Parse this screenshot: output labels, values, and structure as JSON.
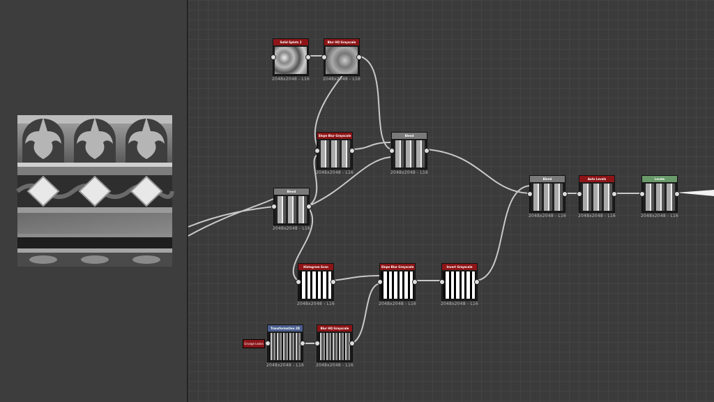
{
  "colors": {
    "red": "#8e1517",
    "blue": "#4a5f8f",
    "green": "#6a9a6a",
    "gray": "#7a7a7a",
    "wire": "#c9c9c9"
  },
  "preview": {
    "label": ""
  },
  "input": {
    "label": "Grunge Leaks"
  },
  "nodes": [
    {
      "id": "n1",
      "title": "Solid Splots 2",
      "size": "2048x2048 - L16",
      "color": "red",
      "thumb": "t-noise"
    },
    {
      "id": "n2",
      "title": "Blur HQ Grayscale",
      "size": "2048x2048 - L16",
      "color": "red",
      "thumb": "t-noise2"
    },
    {
      "id": "n3",
      "title": "Slope Blur Grayscale",
      "size": "2048x2048 - L16",
      "color": "red",
      "thumb": "t-pattern"
    },
    {
      "id": "n4",
      "title": "Blend",
      "size": "2048x2048 - L16",
      "color": "gray",
      "thumb": "t-pattern"
    },
    {
      "id": "n5",
      "title": "Blend",
      "size": "2048x2048 - L16",
      "color": "gray",
      "thumb": "t-pattern"
    },
    {
      "id": "n6",
      "title": "Blend",
      "size": "2048x2048 - L16",
      "color": "gray",
      "thumb": "t-pattern"
    },
    {
      "id": "n7",
      "title": "Auto Levels",
      "size": "2048x2048 - L16",
      "color": "red",
      "thumb": "t-pattern"
    },
    {
      "id": "n8",
      "title": "Levels",
      "size": "2048x2048 - L16",
      "color": "green",
      "thumb": "t-pattern"
    },
    {
      "id": "n9",
      "title": "Histogram Scan",
      "size": "2048x2048 - L16",
      "color": "red",
      "thumb": "t-bw"
    },
    {
      "id": "n10",
      "title": "Slope Blur Grayscale",
      "size": "2048x2048 - L16",
      "color": "red",
      "thumb": "t-bw"
    },
    {
      "id": "n11",
      "title": "Invert Grayscale",
      "size": "2048x2048 - L16",
      "color": "red",
      "thumb": "t-bw"
    },
    {
      "id": "n12",
      "title": "Transformation 2D",
      "size": "2048x2048 - L16",
      "color": "blue",
      "thumb": "t-grunge"
    },
    {
      "id": "n13",
      "title": "Blur HQ Grayscale",
      "size": "2048x2048 - L16",
      "color": "red",
      "thumb": "t-grunge"
    }
  ]
}
